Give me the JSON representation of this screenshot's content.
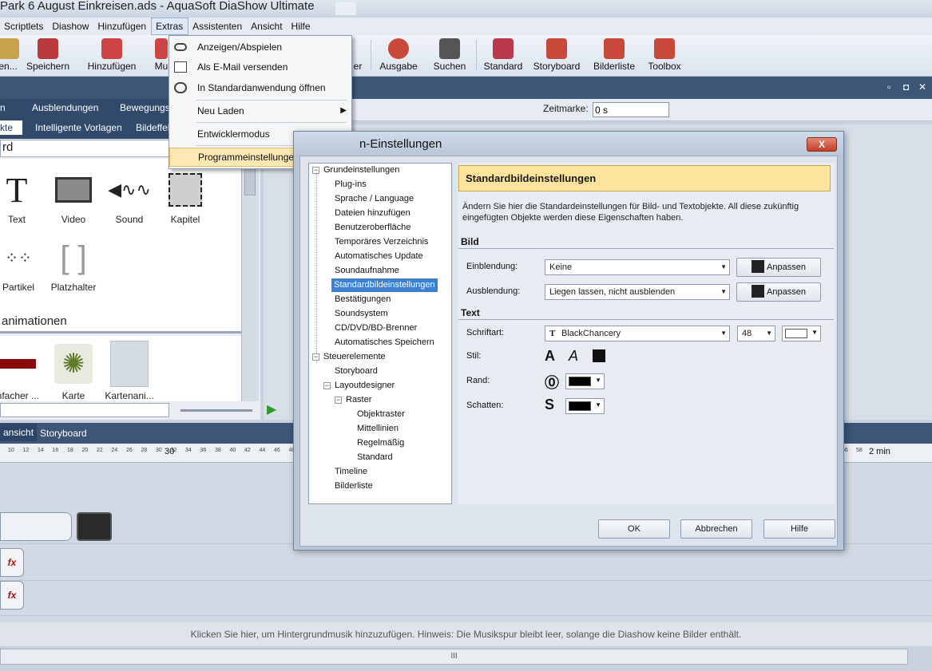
{
  "window": {
    "title": "Park 6 August Einkreisen.ads - AquaSoft DiaShow Ultimate"
  },
  "menubar": [
    "Scriptlets",
    "Diashow",
    "Hinzufügen",
    "Extras",
    "Assistenten",
    "Ansicht",
    "Hilfe"
  ],
  "toolbar": {
    "items": [
      "en...",
      "Speichern",
      "Hinzufügen",
      "Mu",
      "er",
      "Ausgabe",
      "Suchen",
      "Standard",
      "Storyboard",
      "Bilderliste",
      "Toolbox"
    ]
  },
  "extras_menu": {
    "items": [
      "Anzeigen/Abspielen",
      "Als E-Mail versenden",
      "In Standardanwendung öffnen",
      "Neu Laden",
      "Entwicklermodus",
      "Programmeinstellungen"
    ]
  },
  "left_panel": {
    "tabs_row1": [
      "n",
      "Ausblendungen",
      "Bewegungsp"
    ],
    "tabs_row2": [
      "kte",
      "Intelligente Vorlagen",
      "Bildeffek"
    ],
    "search_value": "rd",
    "objects": [
      "Text",
      "Video",
      "Sound",
      "Kapitel",
      "Partikel",
      "Platzhalter"
    ],
    "animations_heading": "animationen",
    "animations": [
      "infacher ...",
      "Karte",
      "Kartenani..."
    ]
  },
  "preview": {
    "zeitmarke_label": "Zeitmarke:",
    "zeitmarke_value": "0 s"
  },
  "timeline": {
    "tabs": [
      "ansicht",
      "Storyboard"
    ],
    "ruler_marks": [
      "10",
      "12",
      "14",
      "16",
      "18",
      "20",
      "22",
      "24",
      "26",
      "28",
      "30",
      "32",
      "34",
      "36",
      "38",
      "40",
      "42",
      "44",
      "46",
      "48",
      "56",
      "58"
    ],
    "ruler_big": [
      "30",
      "2 min"
    ],
    "music_hint": "Klicken Sie hier, um Hintergrundmusik hinzuzufügen. Hinweis: Die Musikspur bleibt leer, solange die Diashow keine Bilder enthält.",
    "scroll_grip": "III"
  },
  "dialog": {
    "title": "n-Einstellungen",
    "close_label": "X",
    "tree": [
      "Grundeinstellungen",
      "Plug-ins",
      "Sprache / Language",
      "Dateien hinzufügen",
      "Benutzeroberfläche",
      "Temporäres Verzeichnis",
      "Automatisches Update",
      "Soundaufnahme",
      "Standardbildeinstellungen",
      "Bestätigungen",
      "Soundsystem",
      "CD/DVD/BD-Brenner",
      "Automatisches Speichern",
      "Steuerelemente",
      "Storyboard",
      "Layoutdesigner",
      "Raster",
      "Objektraster",
      "Mittellinien",
      "Regelmäßig",
      "Standard",
      "Timeline",
      "Bilderliste"
    ],
    "header": "Standardbildeinstellungen",
    "description": "Ändern Sie hier die Standardeinstellungen für Bild- und Textobjekte. All diese zukünftig eingefügten Objekte werden diese Eigenschaften haben.",
    "bild_section": "Bild",
    "einblendung_label": "Einblendung:",
    "einblendung_value": "Keine",
    "ausblendung_label": "Ausblendung:",
    "ausblendung_value": "Liegen lassen, nicht ausblenden",
    "anpassen": "Anpassen",
    "text_section": "Text",
    "schriftart_label": "Schriftart:",
    "schriftart_value": "BlackChancery",
    "font_size": "48",
    "stil_label": "Stil:",
    "rand_label": "Rand:",
    "schatten_label": "Schatten:",
    "ok": "OK",
    "cancel": "Abbrechen",
    "help": "Hilfe"
  }
}
